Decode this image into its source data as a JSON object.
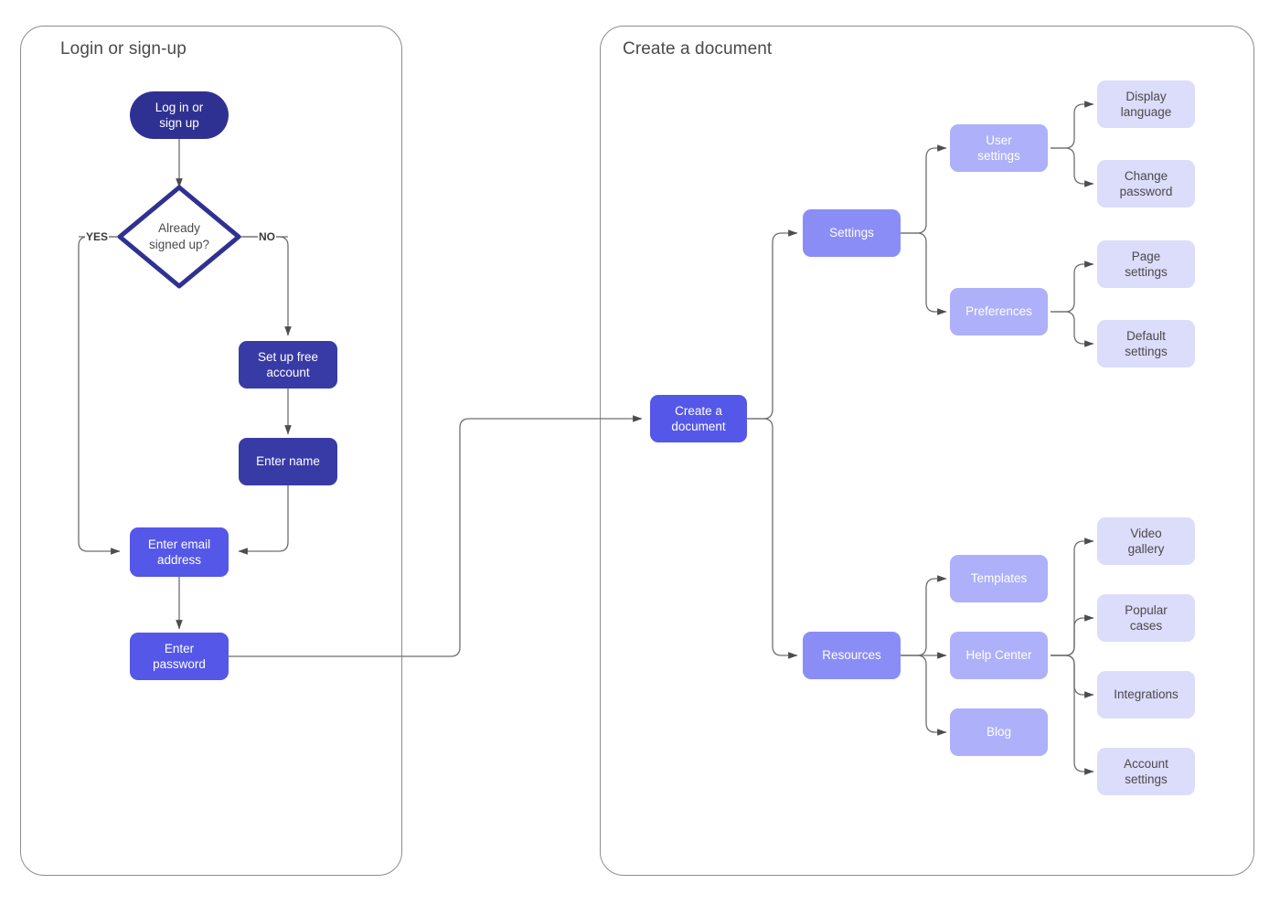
{
  "diagram": {
    "type": "flowchart",
    "title_left": "Login or sign-up",
    "title_right": "Create a document",
    "colors": {
      "terminal": "#2f3192",
      "dark": "#383ba5",
      "royal": "#5557e8",
      "mid": "#8b8df7",
      "peri": "#aeb0fa",
      "light": "#dcdcfb",
      "edge": "#666666",
      "container_border": "#8d8d8d",
      "title_text": "#4a4a4a"
    }
  },
  "containers": [
    {
      "id": "login-container",
      "title": "Login or sign-up"
    },
    {
      "id": "document-container",
      "title": "Create a document"
    }
  ],
  "nodes": {
    "login_signup": "Log in or\nsign up",
    "already_signed_up": "Already\nsigned up?",
    "set_up_free_account": "Set up free\naccount",
    "enter_name": "Enter name",
    "enter_email_address": "Enter email\naddress",
    "enter_password": "Enter\npassword",
    "create_a_document": "Create a\ndocument",
    "settings": "Settings",
    "user_settings": "User\nsettings",
    "display_language": "Display\nlanguage",
    "change_password": "Change\npassword",
    "preferences": "Preferences",
    "page_settings": "Page\nsettings",
    "default_settings": "Default\nsettings",
    "resources": "Resources",
    "templates": "Templates",
    "help_center": "Help Center",
    "blog": "Blog",
    "video_gallery": "Video\ngallery",
    "popular_cases": "Popular\ncases",
    "integrations": "Integrations",
    "account_settings": "Account\nsettings"
  },
  "edge_labels": {
    "yes": "YES",
    "no": "NO"
  }
}
